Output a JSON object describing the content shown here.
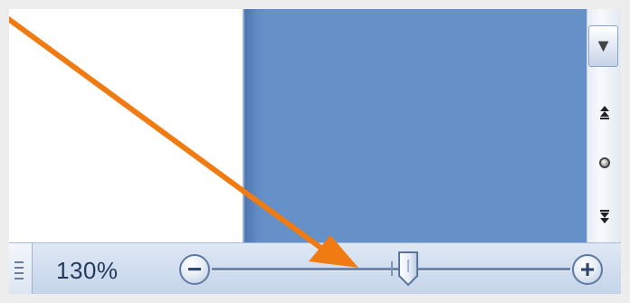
{
  "statusbar": {
    "zoom_level": "130%",
    "zoom_percent": 130,
    "zoom_out_symbol": "−",
    "zoom_in_symbol": "+"
  },
  "scrollbar": {
    "down_arrow_symbol": "▼",
    "prev_page_symbol": "⯭",
    "next_page_symbol": "⯯"
  },
  "colors": {
    "workspace_blue": "#6690c8",
    "annotation_arrow": "#f07b12",
    "statusbar_bg": "#cfdcee"
  },
  "icons": {
    "view_layout": "print-layout-view-icon",
    "zoom_out": "minus-circle-icon",
    "zoom_in": "plus-circle-icon",
    "zoom_thumb": "slider-thumb-icon",
    "scroll_down": "triangle-down-icon",
    "prev_page": "double-up-arrow-icon",
    "browse_object": "round-dot-icon",
    "next_page": "double-down-arrow-icon",
    "annotation": "orange-pointer-arrow-icon"
  }
}
